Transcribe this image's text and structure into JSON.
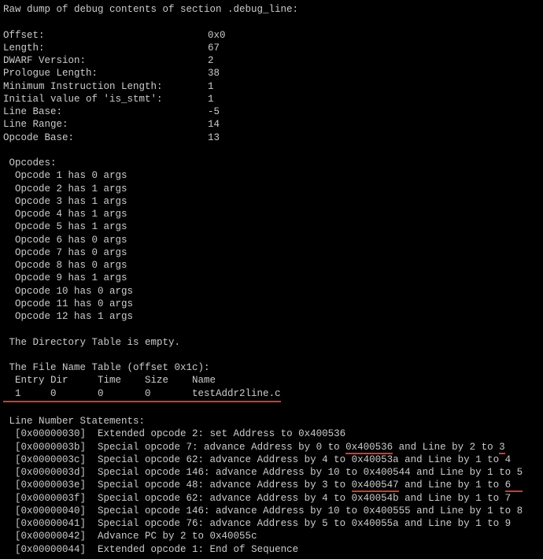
{
  "header": "Raw dump of debug contents of section .debug_line:",
  "fields": [
    {
      "label": "  Offset:",
      "value": "0x0"
    },
    {
      "label": "  Length:",
      "value": "67"
    },
    {
      "label": "  DWARF Version:",
      "value": "2"
    },
    {
      "label": "  Prologue Length:",
      "value": "38"
    },
    {
      "label": "  Minimum Instruction Length:",
      "value": "1"
    },
    {
      "label": "  Initial value of 'is_stmt':",
      "value": "1"
    },
    {
      "label": "  Line Base:",
      "value": "-5"
    },
    {
      "label": "  Line Range:",
      "value": "14"
    },
    {
      "label": "  Opcode Base:",
      "value": "13"
    }
  ],
  "opcodes_header": " Opcodes:",
  "opcodes": [
    "  Opcode 1 has 0 args",
    "  Opcode 2 has 1 args",
    "  Opcode 3 has 1 args",
    "  Opcode 4 has 1 args",
    "  Opcode 5 has 1 args",
    "  Opcode 6 has 0 args",
    "  Opcode 7 has 0 args",
    "  Opcode 8 has 0 args",
    "  Opcode 9 has 1 args",
    "  Opcode 10 has 0 args",
    "  Opcode 11 has 0 args",
    "  Opcode 12 has 1 args"
  ],
  "dir_table": " The Directory Table is empty.",
  "file_table_header": " The File Name Table (offset 0x1c):",
  "file_table_cols": {
    "entry": "  Entry",
    "dir": "Dir",
    "time": "Time",
    "size": "Size",
    "name": "Name"
  },
  "file_table_row": {
    "entry": "  1",
    "dir": "0",
    "time": "0",
    "size": "0",
    "name": "testAddr2line.c"
  },
  "stmts_header": " Line Number Statements:",
  "stmts": [
    {
      "addr": "  [0x00000030]  ",
      "txt": "Extended opcode 2: set Address to 0x400536"
    },
    {
      "addr": "  [0x0000003b]  ",
      "p1": "Special opcode 7: advance Address by 0 to ",
      "hl1": "0x400536",
      "p2": " and Line by 2 to ",
      "hl2": "3"
    },
    {
      "addr": "  [0x0000003c]  ",
      "txt": "Special opcode 62: advance Address by 4 to 0x40053a and Line by 1 to 4"
    },
    {
      "addr": "  [0x0000003d]  ",
      "txt": "Special opcode 146: advance Address by 10 to 0x400544 and Line by 1 to 5"
    },
    {
      "addr": "  [0x0000003e]  ",
      "p1": "Special opcode 48: advance Address by 3 to ",
      "hl1": "0x400547",
      "p2": " and Line by 1 to ",
      "hl2": "6  "
    },
    {
      "addr": "  [0x0000003f]  ",
      "txt": "Special opcode 62: advance Address by 4 to 0x40054b and Line by 1 to 7"
    },
    {
      "addr": "  [0x00000040]  ",
      "txt": "Special opcode 146: advance Address by 10 to 0x400555 and Line by 1 to 8"
    },
    {
      "addr": "  [0x00000041]  ",
      "txt": "Special opcode 76: advance Address by 5 to 0x40055a and Line by 1 to 9"
    },
    {
      "addr": "  [0x00000042]  ",
      "txt": "Advance PC by 2 to 0x40055c"
    },
    {
      "addr": "  [0x00000044]  ",
      "txt": "Extended opcode 1: End of Sequence"
    }
  ]
}
